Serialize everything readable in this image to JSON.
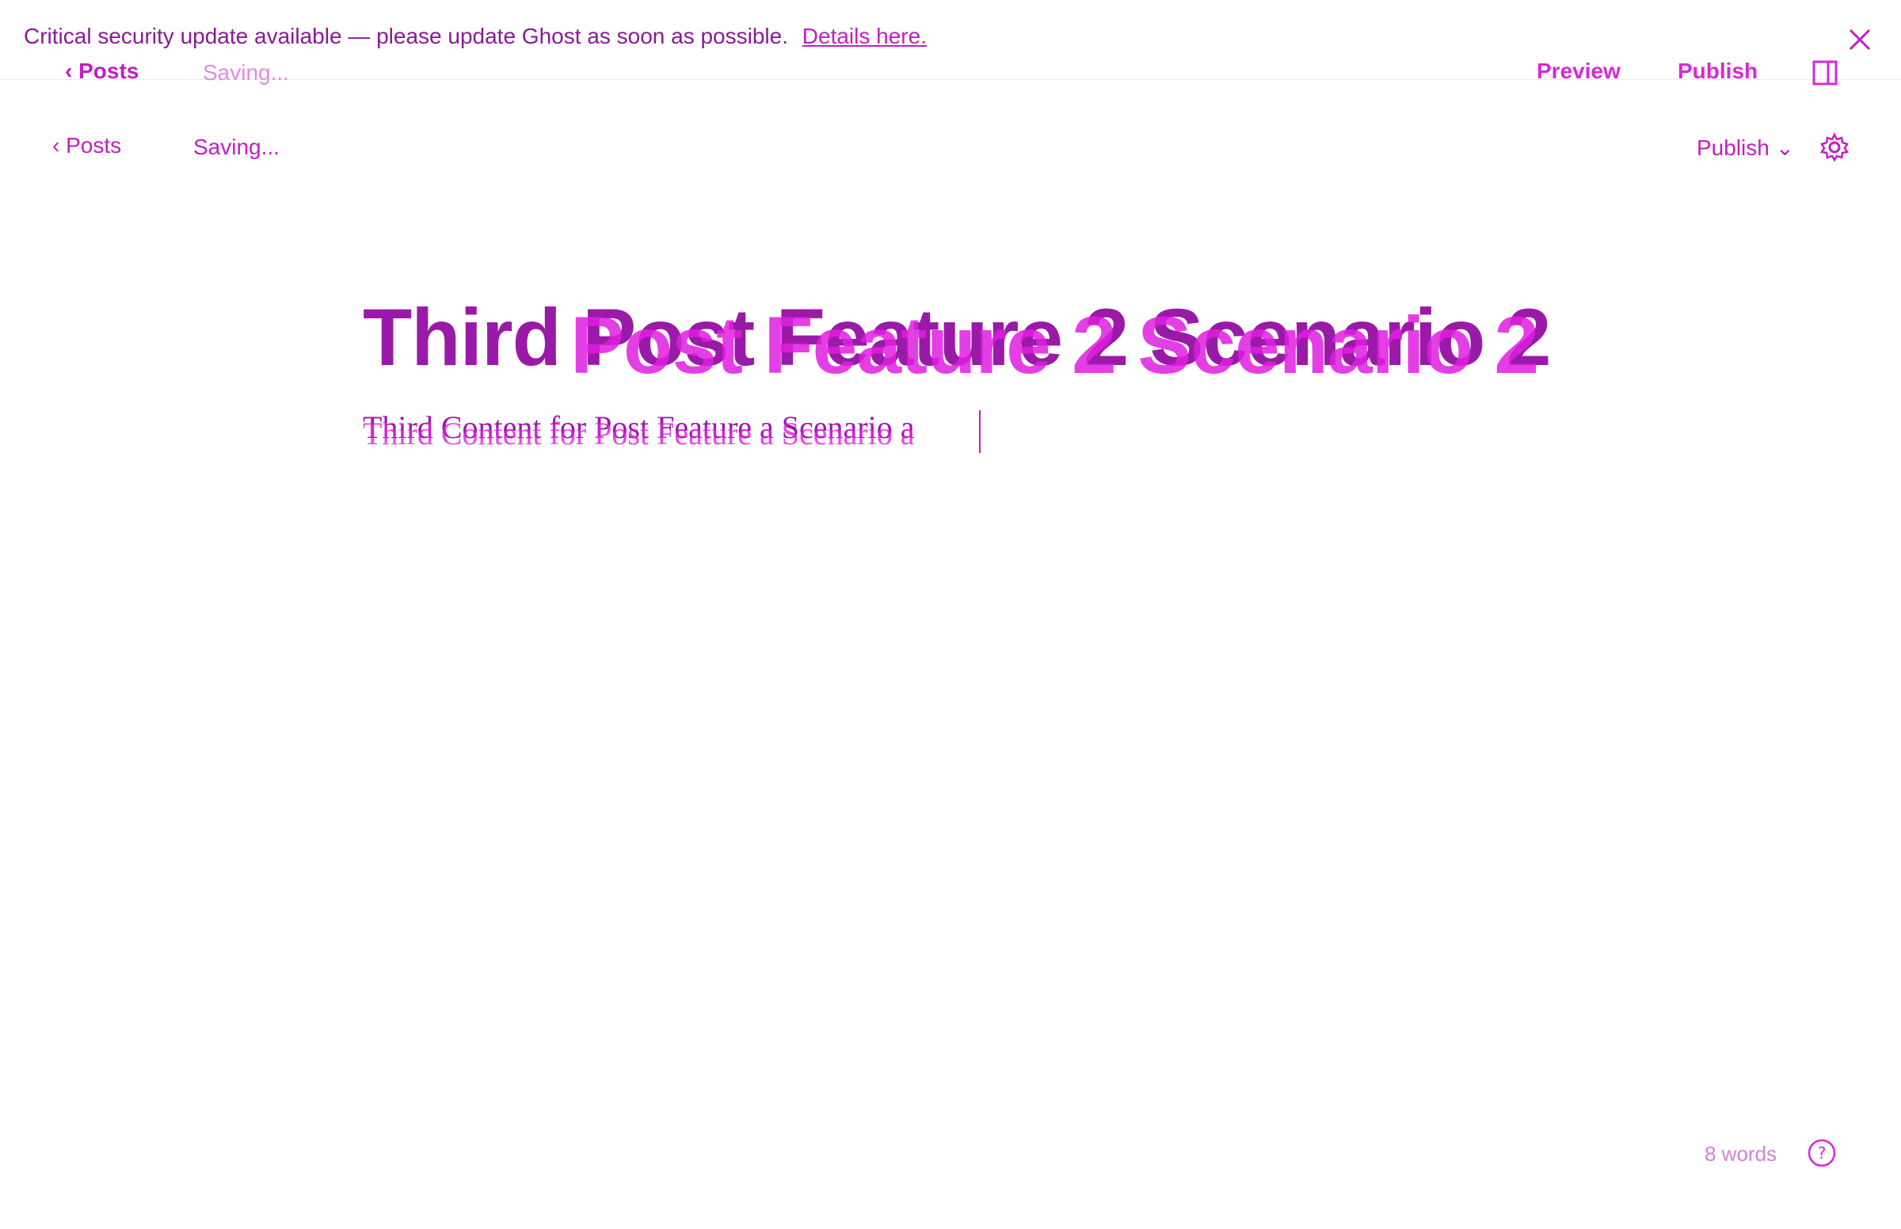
{
  "banner": {
    "message": "Critical security update available — please update Ghost as soon as possible.",
    "link_text": "Details here."
  },
  "overlay_header": {
    "back_label": "Posts",
    "status": "Saving...",
    "preview_label": "Preview",
    "publish_label": "Publish"
  },
  "editor_header": {
    "back_label": "Posts",
    "status": "Saving...",
    "publish_label": "Publish"
  },
  "post": {
    "title_primary": "Third Post Feature 2 Scenario 2",
    "title_secondary": "Post Feature 2 Scenario 2",
    "body_primary": "Third Content for Post Feature a Scenario a",
    "body_secondary": "Third Content for Post Feature a Scenario a"
  },
  "footer": {
    "word_count": "8 words"
  },
  "colors": {
    "accent": "#d62ad6",
    "accent_dark": "#9a1aa8",
    "accent_light": "#e08ce0"
  },
  "icons": {
    "banner_close": "close-icon",
    "overlay_panel": "sidebar-panel-icon",
    "settings": "gear-icon",
    "help": "help-icon"
  }
}
